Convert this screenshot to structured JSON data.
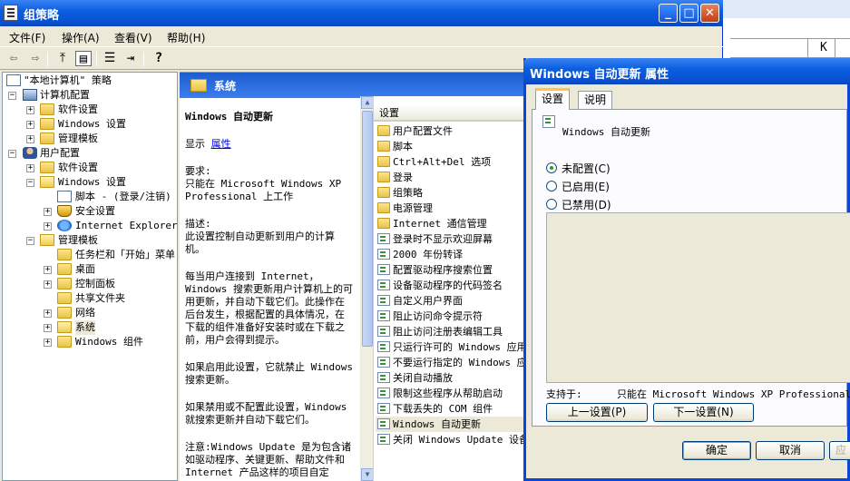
{
  "window": {
    "title": "组策略",
    "controls": {
      "minimize": "_",
      "maximize": "□",
      "close": "✕"
    }
  },
  "menu": [
    {
      "label": "文件(F)"
    },
    {
      "label": "操作(A)"
    },
    {
      "label": "查看(V)"
    },
    {
      "label": "帮助(H)"
    }
  ],
  "toolbar": {
    "icons": [
      "back-arrow-icon",
      "forward-arrow-icon",
      "up-folder-icon",
      "show-hide-tree-icon",
      "properties-icon",
      "export-list-icon",
      "help-icon"
    ],
    "glyphs": {
      "back": "⇦",
      "forward": "⇨",
      "up": "⤒",
      "tree": "▤",
      "props": "☰",
      "export": "⇥",
      "help": "?"
    }
  },
  "tree": {
    "items": [
      {
        "label": "\"本地计算机\" 策略",
        "icon": "policy-icon",
        "expander": "",
        "depth": 0
      },
      {
        "label": "计算机配置",
        "icon": "computer-icon",
        "expander": "−",
        "depth": 1
      },
      {
        "label": "软件设置",
        "icon": "folder-icon",
        "expander": "+",
        "depth": 2
      },
      {
        "label": "Windows 设置",
        "icon": "folder-icon",
        "expander": "+",
        "depth": 2
      },
      {
        "label": "管理模板",
        "icon": "folder-icon",
        "expander": "+",
        "depth": 2
      },
      {
        "label": "用户配置",
        "icon": "user-icon",
        "expander": "−",
        "depth": 1
      },
      {
        "label": "软件设置",
        "icon": "folder-icon",
        "expander": "+",
        "depth": 2
      },
      {
        "label": "Windows 设置",
        "icon": "folder-icon",
        "expander": "−",
        "depth": 2
      },
      {
        "label": "脚本 - (登录/注销)",
        "icon": "document-icon",
        "expander": "",
        "depth": 3
      },
      {
        "label": "安全设置",
        "icon": "shield-icon",
        "expander": "+",
        "depth": 3
      },
      {
        "label": "Internet Explorer 维",
        "icon": "internet-explorer-icon",
        "expander": "+",
        "depth": 3
      },
      {
        "label": "管理模板",
        "icon": "folder-icon",
        "expander": "−",
        "depth": 2
      },
      {
        "label": "任务栏和「开始」菜单",
        "icon": "folder-icon",
        "expander": "",
        "depth": 3
      },
      {
        "label": "桌面",
        "icon": "folder-icon",
        "expander": "+",
        "depth": 3
      },
      {
        "label": "控制面板",
        "icon": "folder-icon",
        "expander": "+",
        "depth": 3
      },
      {
        "label": "共享文件夹",
        "icon": "folder-icon",
        "expander": "",
        "depth": 3
      },
      {
        "label": "网络",
        "icon": "folder-icon",
        "expander": "+",
        "depth": 3
      },
      {
        "label": "系统",
        "icon": "folder-open-icon",
        "expander": "+",
        "depth": 3,
        "selected": true
      },
      {
        "label": "Windows 组件",
        "icon": "folder-icon",
        "expander": "+",
        "depth": 3
      }
    ]
  },
  "description": {
    "header": "系统",
    "title": "Windows 自动更新",
    "display_label": "显示",
    "properties_link": "属性",
    "requirement_label": "要求:",
    "requirement_text": "只能在 Microsoft Windows XP Professional 上工作",
    "desc_label": "描述:",
    "desc_text": "此设置控制自动更新到用户的计算机。",
    "para1": "每当用户连接到 Internet，Windows 搜索更新用户计算机上的可用更新，并自动下载它们。此操作在后台发生，根据配置的具体情况，在下载的组件准备好安装时或在下载之前，用户会得到提示。",
    "para2": "如果启用此设置，它就禁止 Windows 搜索更新。",
    "para3": "如果禁用或不配置此设置，Windows 就搜索更新并自动下载它们。",
    "para4": "注意:Windows Update 是为包含诸如驱动程序、关键更新、帮助文件和 Internet 产品这样的项目自定"
  },
  "settings_list": {
    "column_header": "设置",
    "items": [
      {
        "label": "用户配置文件",
        "icon": "folder-icon"
      },
      {
        "label": "脚本",
        "icon": "folder-icon"
      },
      {
        "label": "Ctrl+Alt+Del 选项",
        "icon": "folder-icon"
      },
      {
        "label": "登录",
        "icon": "folder-icon"
      },
      {
        "label": "组策略",
        "icon": "folder-icon"
      },
      {
        "label": "电源管理",
        "icon": "folder-icon"
      },
      {
        "label": "Internet 通信管理",
        "icon": "folder-icon"
      },
      {
        "label": "登录时不显示欢迎屏幕",
        "icon": "setting-icon"
      },
      {
        "label": "2000 年份转译",
        "icon": "setting-icon"
      },
      {
        "label": "配置驱动程序搜索位置",
        "icon": "setting-icon"
      },
      {
        "label": "设备驱动程序的代码签名",
        "icon": "setting-icon"
      },
      {
        "label": "自定义用户界面",
        "icon": "setting-icon"
      },
      {
        "label": "阻止访问命令提示符",
        "icon": "setting-icon"
      },
      {
        "label": "阻止访问注册表编辑工具",
        "icon": "setting-icon"
      },
      {
        "label": "只运行许可的 Windows 应用",
        "icon": "setting-icon"
      },
      {
        "label": "不要运行指定的 Windows 应",
        "icon": "setting-icon"
      },
      {
        "label": "关闭自动播放",
        "icon": "setting-icon"
      },
      {
        "label": "限制这些程序从帮助启动",
        "icon": "setting-icon"
      },
      {
        "label": "下载丢失的 COM 组件",
        "icon": "setting-icon"
      },
      {
        "label": "Windows 自动更新",
        "icon": "setting-icon",
        "selected": true
      },
      {
        "label": "关闭 Windows Update 设备",
        "icon": "setting-icon"
      }
    ]
  },
  "dialog": {
    "title": "Windows 自动更新 属性",
    "tabs": [
      {
        "label": "设置",
        "active": true
      },
      {
        "label": "说明",
        "active": false
      }
    ],
    "policy_name": "Windows 自动更新",
    "options": [
      {
        "label": "未配置(C)",
        "checked": true
      },
      {
        "label": "已启用(E)",
        "checked": false
      },
      {
        "label": "已禁用(D)",
        "checked": false
      }
    ],
    "supported_label": "支持于:",
    "supported_value": "只能在 Microsoft Windows XP Professional ...",
    "prev_button": "上一设置(P)",
    "next_button": "下一设置(N)",
    "ok_button": "确定",
    "cancel_button": "取消",
    "apply_button": "应"
  },
  "background": {
    "column_letter": "K"
  },
  "colors": {
    "xp_blue": "#0a5fe0",
    "xp_face": "#ece9d8",
    "link": "#0000ff"
  }
}
